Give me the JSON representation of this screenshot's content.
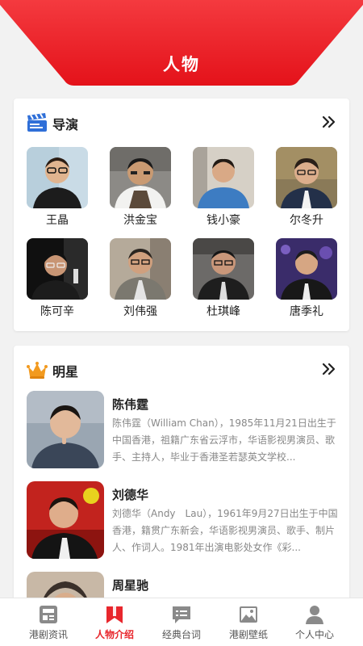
{
  "header": {
    "title": "人物"
  },
  "directors": {
    "title": "导演",
    "icon": "clapperboard-icon",
    "more_icon": "double-chevron-right-icon",
    "items": [
      {
        "name": "王晶"
      },
      {
        "name": "洪金宝"
      },
      {
        "name": "钱小豪"
      },
      {
        "name": "尔冬升"
      },
      {
        "name": "陈可辛"
      },
      {
        "name": "刘伟强"
      },
      {
        "name": "杜琪峰"
      },
      {
        "name": "唐季礼"
      }
    ]
  },
  "stars": {
    "title": "明星",
    "icon": "crown-icon",
    "more_icon": "double-chevron-right-icon",
    "items": [
      {
        "name": "陈伟霆",
        "desc": "陈伟霆（William Chan），1985年11月21日出生于中国香港，祖籍广东省云浮市，华语影视男演员、歌手、主持人，毕业于香港圣若瑟英文学校..."
      },
      {
        "name": "刘德华",
        "desc": "刘德华（Andy　Lau），1961年9月27日出生于中国香港，籍贯广东新会，华语影视男演员、歌手、制片人、作词人。1981年出演电影处女作《彩..."
      },
      {
        "name": "周星驰",
        "desc": ""
      }
    ]
  },
  "tabbar": {
    "tabs": [
      {
        "label": "港剧资讯",
        "icon": "news-icon",
        "active": false
      },
      {
        "label": "人物介绍",
        "icon": "bookmark-icon",
        "active": true
      },
      {
        "label": "经典台词",
        "icon": "chat-icon",
        "active": false
      },
      {
        "label": "港剧壁纸",
        "icon": "picture-icon",
        "active": false
      },
      {
        "label": "个人中心",
        "icon": "user-icon",
        "active": false
      }
    ]
  },
  "colors": {
    "accent": "#e8272d",
    "inactive": "#888888",
    "background": "#f2f2f2"
  }
}
